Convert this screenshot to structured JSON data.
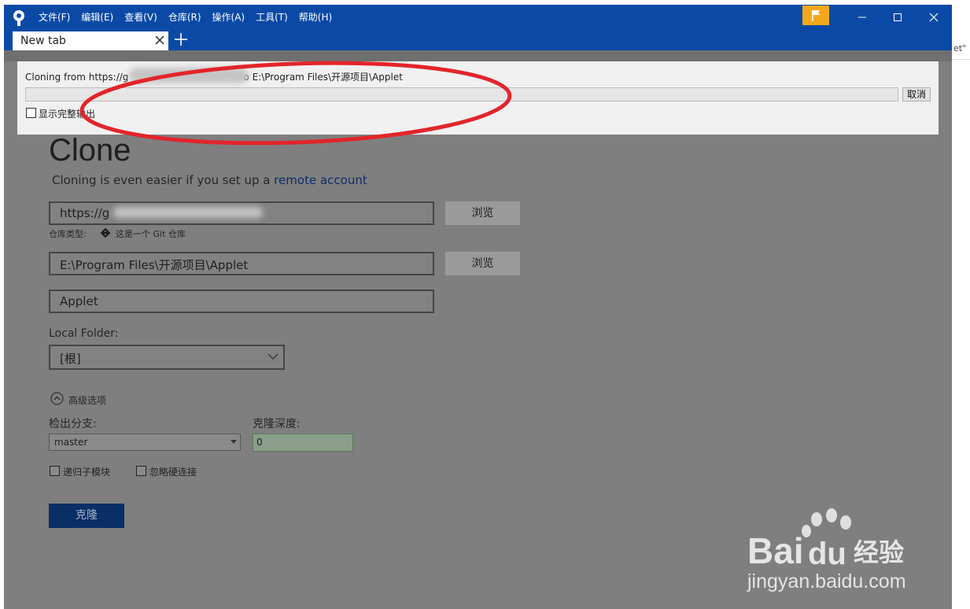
{
  "menu": [
    "文件(F)",
    "编辑(E)",
    "查看(V)",
    "仓库(R)",
    "操作(A)",
    "工具(T)",
    "帮助(H)"
  ],
  "tab": {
    "label": "New tab"
  },
  "progress": {
    "text_prefix": "Cloning from https://g",
    "text_suffix": "o E:\\Program Files\\开源项目\\Applet",
    "fraction": 0,
    "cancel_label": "取消",
    "show_full_output_label": "显示完整输出"
  },
  "clone_page": {
    "title": "Clone",
    "subtitle_text": "Cloning is even easier if you set up a ",
    "subtitle_link": "remote account",
    "source_url": "https://g",
    "browse_label": "浏览",
    "repo_type_label": "仓库类型:",
    "repo_type_value": "这是一个 Git 仓库",
    "dest_path": "E:\\Program Files\\开源项目\\Applet",
    "name": "Applet",
    "local_folder_label": "Local Folder:",
    "local_folder_value": "[根]",
    "advanced_label": "高级选项",
    "branch_label": "检出分支:",
    "branch_value": "master",
    "depth_label": "克隆深度:",
    "depth_value": "0",
    "recurse_label": "递归子模块",
    "ignore_hardlinks_label": "忽略硬连接",
    "clone_button": "克隆"
  },
  "edge_text": "et\"",
  "colors": {
    "titlebar": "#0a4aa6",
    "flag": "#f3a81b",
    "overlay": "#7f7f7f",
    "clone_button": "#0a2e66"
  }
}
